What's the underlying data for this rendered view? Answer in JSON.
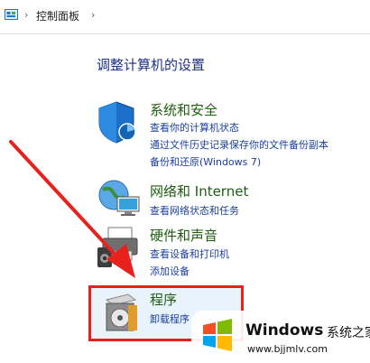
{
  "breadcrumb": {
    "separator": "›",
    "item": "控制面板"
  },
  "page_title": "调整计算机的设置",
  "categories": [
    {
      "title": "系统和安全",
      "links": [
        "查看你的计算机状态",
        "通过文件历史记录保存你的文件备份副本",
        "备份和还原(Windows 7)"
      ]
    },
    {
      "title": "网络和 Internet",
      "links": [
        "查看网络状态和任务"
      ]
    },
    {
      "title": "硬件和声音",
      "links": [
        "查看设备和打印机",
        "添加设备"
      ]
    },
    {
      "title": "程序",
      "links": [
        "卸载程序"
      ]
    }
  ],
  "watermark": {
    "brand": "Windows",
    "brand_cn": "系统之家",
    "url": "www.bjjmlv.com"
  },
  "colors": {
    "highlight_box": "#e8211d",
    "arrow": "#e8211d",
    "category_title": "#1e5d0f",
    "link": "#1a3fa0"
  }
}
